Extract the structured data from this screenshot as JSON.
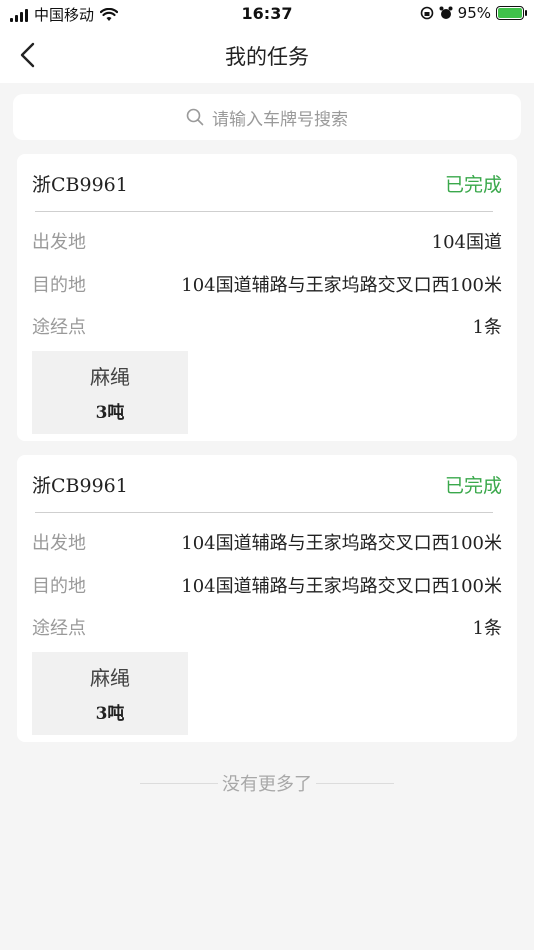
{
  "status_bar": {
    "carrier": "中国移动",
    "time": "16:37",
    "battery": "95%"
  },
  "nav": {
    "title": "我的任务"
  },
  "search": {
    "placeholder": "请输入车牌号搜索"
  },
  "tasks": [
    {
      "plate": "浙CB9961",
      "status": "已完成",
      "origin_label": "出发地",
      "origin": "104国道",
      "destination_label": "目的地",
      "destination": "104国道辅路与王家坞路交叉口西100米",
      "waypoints_label": "途经点",
      "waypoints": "1条",
      "goods_name": "麻绳",
      "goods_weight": "3吨"
    },
    {
      "plate": "浙CB9961",
      "status": "已完成",
      "origin_label": "出发地",
      "origin": "104国道辅路与王家坞路交叉口西100米",
      "destination_label": "目的地",
      "destination": "104国道辅路与王家坞路交叉口西100米",
      "waypoints_label": "途经点",
      "waypoints": "1条",
      "goods_name": "麻绳",
      "goods_weight": "3吨"
    }
  ],
  "footer": {
    "no_more": "没有更多了"
  },
  "colors": {
    "accent_green": "#3aa84b",
    "background": "#f5f5f5"
  }
}
